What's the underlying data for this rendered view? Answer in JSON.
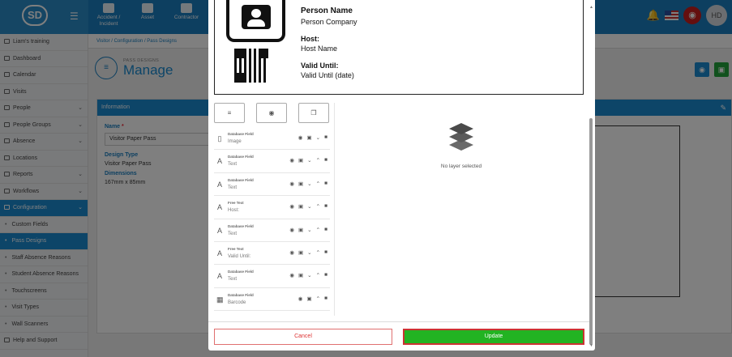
{
  "app": {
    "logo_text": "SD"
  },
  "topnav": [
    {
      "label": "Accident / Incident",
      "icon": "medical-icon"
    },
    {
      "label": "Asset",
      "icon": "asset-icon"
    },
    {
      "label": "Contractor",
      "icon": "contractor-icon"
    },
    {
      "label": "",
      "icon": "visitor-icon"
    },
    {
      "label": "",
      "icon": "user-icon"
    },
    {
      "label": "",
      "icon": "user-icon"
    }
  ],
  "user": {
    "initials": "HD"
  },
  "sidebar": {
    "items": [
      {
        "label": "Liam's training",
        "icon": "location-pin-icon",
        "chevron": false
      },
      {
        "label": "Dashboard",
        "icon": "grid-icon",
        "chevron": false
      },
      {
        "label": "Calendar",
        "icon": "calendar-icon",
        "chevron": false
      },
      {
        "label": "Visits",
        "icon": "visits-icon",
        "chevron": false
      },
      {
        "label": "People",
        "icon": "people-icon",
        "chevron": true
      },
      {
        "label": "People Groups",
        "icon": "people-groups-icon",
        "chevron": true
      },
      {
        "label": "Absence",
        "icon": "absence-icon",
        "chevron": true
      },
      {
        "label": "Locations",
        "icon": "building-icon",
        "chevron": false
      },
      {
        "label": "Reports",
        "icon": "reports-icon",
        "chevron": true
      },
      {
        "label": "Workflows",
        "icon": "workflows-icon",
        "chevron": true
      },
      {
        "label": "Configuration",
        "icon": "configuration-icon",
        "chevron": true
      },
      {
        "label": "Custom Fields",
        "sub": true
      },
      {
        "label": "Pass Designs",
        "sub": true
      },
      {
        "label": "Staff Absence Reasons",
        "sub": true
      },
      {
        "label": "Student Absence Reasons",
        "sub": true
      },
      {
        "label": "Touchscreens",
        "sub": true
      },
      {
        "label": "Visit Types",
        "sub": true
      },
      {
        "label": "Wall Scanners",
        "sub": true
      },
      {
        "label": "Help and Support",
        "icon": "help-icon",
        "chevron": false
      }
    ]
  },
  "breadcrumb": {
    "a": "Visitor",
    "b": "Configuration",
    "c": "Pass Designs"
  },
  "page": {
    "sup_title": "PASS DESIGNS",
    "title": "Manage"
  },
  "info": {
    "header": "Information",
    "name_label": "Name",
    "name_value": "Visitor Paper Pass",
    "design_type_label": "Design Type",
    "design_type_value": "Visitor Paper Pass",
    "dimensions_label": "Dimensions",
    "dimensions_value": "167mm x 85mm"
  },
  "card": {
    "person_name": "Person Name",
    "person_company": "Person Company",
    "host_label": "Host:",
    "host_value": "Host Name",
    "valid_label": "Valid Until:",
    "valid_value": "Valid Until (date)"
  },
  "toolbar": {
    "btn1": "≡",
    "btn2": "◉",
    "btn3": "❐"
  },
  "layers": [
    {
      "type": "Database Field",
      "name": "Image",
      "icon": "image-layer-icon",
      "up": false
    },
    {
      "type": "Database Field",
      "name": "Text",
      "icon": "text-layer-icon",
      "up": true
    },
    {
      "type": "Database Field",
      "name": "Text",
      "icon": "text-layer-icon",
      "up": true
    },
    {
      "type": "Free Text",
      "name": "Host:",
      "icon": "text-layer-icon",
      "up": true
    },
    {
      "type": "Database Field",
      "name": "Text",
      "icon": "text-layer-icon",
      "up": true
    },
    {
      "type": "Free Text",
      "name": "Valid Until:",
      "icon": "text-layer-icon",
      "up": true
    },
    {
      "type": "Database Field",
      "name": "Text",
      "icon": "text-layer-icon",
      "up": true
    },
    {
      "type": "Database Field",
      "name": "Barcode",
      "icon": "barcode-layer-icon",
      "up": true
    }
  ],
  "empty_state": {
    "text": "No layer selected"
  },
  "buttons": {
    "cancel": "Cancel",
    "update": "Update"
  },
  "colors": {
    "primary": "#1a8ad0",
    "update": "#22b322",
    "danger": "#c81e1e"
  }
}
